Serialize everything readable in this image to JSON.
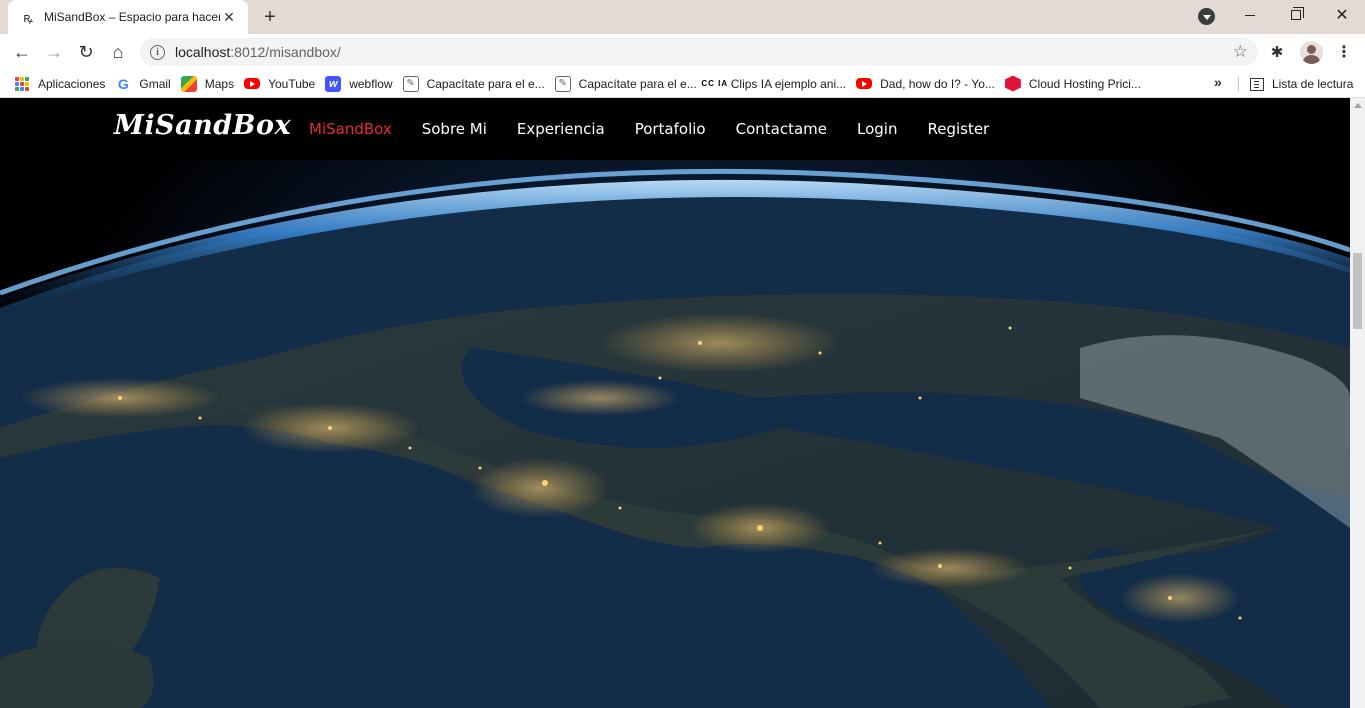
{
  "browser": {
    "tab": {
      "title": "MiSandBox – Espacio para hacer",
      "favicon_glyph": "ꝶ",
      "close_glyph": "✕"
    },
    "new_tab_glyph": "+",
    "window": {
      "close_glyph": "✕"
    },
    "toolbar": {
      "back_glyph": "←",
      "forward_glyph": "→",
      "reload_glyph": "↻",
      "home_glyph": "⌂",
      "url_host": "localhost",
      "url_path": ":8012/misandbox/",
      "star_glyph": "☆",
      "extensions_glyph": "✱",
      "menu_glyph": "⋮"
    },
    "bookmarks": [
      {
        "label": "Aplicaciones",
        "icon": "apps-grid-icon"
      },
      {
        "label": "Gmail",
        "icon": "google-icon",
        "glyph": "G"
      },
      {
        "label": "Maps",
        "icon": "maps-icon"
      },
      {
        "label": "YouTube",
        "icon": "youtube-icon"
      },
      {
        "label": "webflow",
        "icon": "webflow-icon",
        "glyph": "w"
      },
      {
        "label": "Capacítate para el e...",
        "icon": "edit-page-icon",
        "glyph": "✎"
      },
      {
        "label": "Capacítate para el e...",
        "icon": "edit-page-icon",
        "glyph": "✎"
      },
      {
        "label": "Clips IA ejemplo ani...",
        "icon": "ccia-icon",
        "glyph": "CC IA"
      },
      {
        "label": "Dad, how do I? - Yo...",
        "icon": "youtube-icon"
      },
      {
        "label": "Cloud Hosting Prici...",
        "icon": "cloud-hex-icon"
      }
    ],
    "bookmarks_more_glyph": "»",
    "reading_list_label": "Lista de lectura"
  },
  "site": {
    "brand": "MiSandBox",
    "nav": [
      {
        "label": "MiSandBox",
        "active": true
      },
      {
        "label": "Sobre Mi",
        "active": false
      },
      {
        "label": "Experiencia",
        "active": false
      },
      {
        "label": "Portafolio",
        "active": false
      },
      {
        "label": "Contactame",
        "active": false
      },
      {
        "label": "Login",
        "active": false
      },
      {
        "label": "Register",
        "active": false
      }
    ],
    "hero_image": "earth-at-night-from-space"
  },
  "colors": {
    "nav_active": "#e8293b",
    "nav_text": "#ffffff",
    "navbar_bg": "#000000",
    "tabstrip_bg": "#e3d9d5",
    "ocean": "#13314f",
    "atmosphere": "#4aa8ff",
    "city_lights": "#ffc066"
  }
}
